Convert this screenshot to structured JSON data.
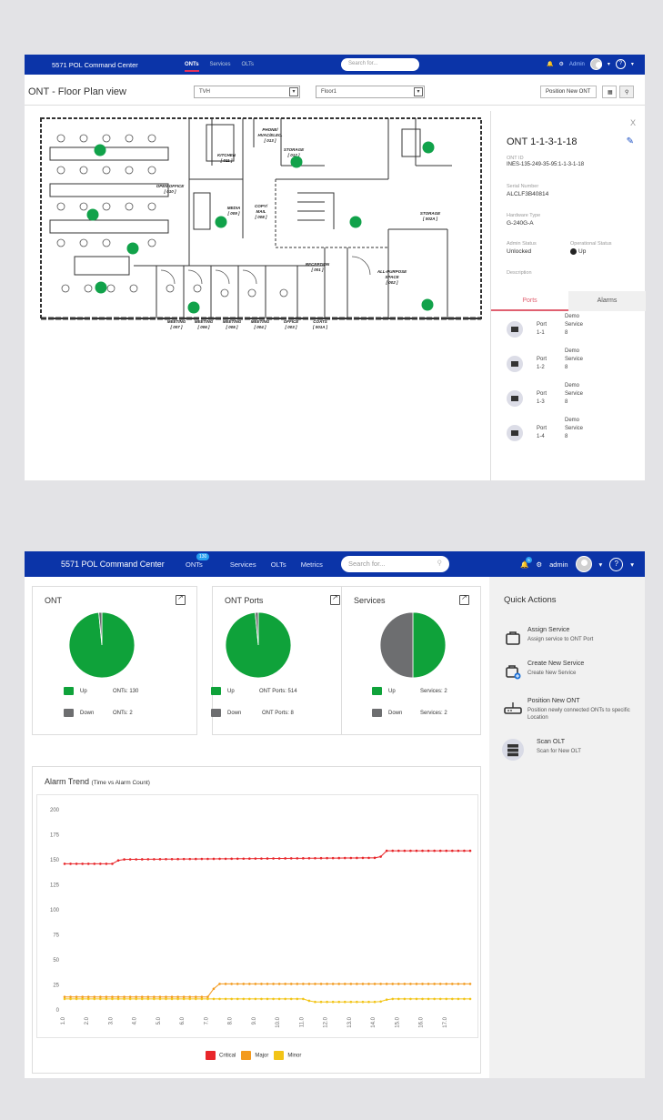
{
  "floor_plan_view": {
    "app_title": "5571 POL Command Center",
    "nav": [
      "ONTs",
      "Services",
      "OLTs"
    ],
    "search_placeholder": "Search for...",
    "user": "Admin",
    "page_title": "ONT - Floor Plan view",
    "building_select": "TVH",
    "floor_select": "Floor1",
    "position_button": "Position New ONT",
    "rooms": [
      "OPEN OFFICE",
      "[ 010 ]",
      "KITCHEN",
      "[ 011 ]",
      "PHONE/",
      "HVAC/ELEC.",
      "[ 013 ]",
      "STORAGE",
      "[ 012 ]",
      "MEDIA",
      "[ 009 ]",
      "COPY/",
      "MAIL",
      "[ 008 ]",
      "STORAGE",
      "[ 002A ]",
      "RECEPTION",
      "[ 001 ]",
      "ALL-PURPOSE",
      "SPACE",
      "[ 002 ]",
      "MEETING",
      "[ 007 ]",
      "MEETING",
      "[ 006 ]",
      "MEETING",
      "[ 005 ]",
      "MEETING",
      "[ 004 ]",
      "OFFICE",
      "[ 003 ]",
      "COATS",
      "[ 001A ]"
    ],
    "ont_detail": {
      "close": "X",
      "name": "ONT 1-1-3-1-18",
      "ont_id_label": "ONT ID",
      "ont_id": "INES-135-249-35-95:1-1-3-1-18",
      "serial_label": "Serial Number",
      "serial": "ALCLF3B40814",
      "hw_label": "Hardware Type",
      "hw": "G-240G-A",
      "admin_label": "Admin Status",
      "admin": "Unlocked",
      "oper_label": "Operational Status",
      "oper": "Up",
      "desc_label": "Description",
      "tabs": [
        "Ports",
        "Alarms"
      ],
      "ports": [
        {
          "port": [
            "Port",
            "1-1"
          ],
          "service": [
            "Demo",
            "Service",
            "8"
          ]
        },
        {
          "port": [
            "Port",
            "1-2"
          ],
          "service": [
            "Demo",
            "Service",
            "8"
          ]
        },
        {
          "port": [
            "Port",
            "1-3"
          ],
          "service": [
            "Demo",
            "Service",
            "8"
          ]
        },
        {
          "port": [
            "Port",
            "1-4"
          ],
          "service": [
            "Demo",
            "Service",
            "8"
          ]
        }
      ]
    }
  },
  "dashboard": {
    "app_title": "5571 POL Command Center",
    "nav": [
      "ONTs",
      "Services",
      "OLTs",
      "Metrics"
    ],
    "onts_badge": "130",
    "search_placeholder": "Search for...",
    "bell_badge": "5",
    "user": "admin",
    "cards": [
      {
        "title": "ONT",
        "up_label": "Up",
        "up_text": "ONTs: 130",
        "down_label": "Down",
        "down_text": "ONTs: 2"
      },
      {
        "title": "ONT Ports",
        "up_label": "Up",
        "up_text": "ONT Ports: 514",
        "down_label": "Down",
        "down_text": "ONT Ports: 8"
      },
      {
        "title": "Services",
        "up_label": "Up",
        "up_text": "Services: 2",
        "down_label": "Down",
        "down_text": "Services: 2"
      }
    ],
    "quick_actions": {
      "title": "Quick Actions",
      "items": [
        {
          "name": "Assign Service",
          "desc": "Assign service to ONT Port"
        },
        {
          "name": "Create New Service",
          "desc": "Create New Service"
        },
        {
          "name": "Position New ONT",
          "desc": "Position newly connected ONTs to specific Location"
        },
        {
          "name": "Scan OLT",
          "desc": "Scan for New OLT"
        }
      ]
    },
    "trend_title": "Alarm Trend",
    "trend_subtitle": "(Time vs Alarm Count)"
  },
  "colors": {
    "up": "#0fa23a",
    "down": "#6d6e70",
    "critical": "#e8262a",
    "major": "#f39a1e",
    "minor": "#f2c417",
    "nav_bg": "#0b34a8"
  },
  "chart_data": [
    {
      "type": "pie",
      "title": "ONT",
      "categories": [
        "Up",
        "Down"
      ],
      "values": [
        130,
        2
      ]
    },
    {
      "type": "pie",
      "title": "ONT Ports",
      "categories": [
        "Up",
        "Down"
      ],
      "values": [
        514,
        8
      ]
    },
    {
      "type": "pie",
      "title": "Services",
      "categories": [
        "Up",
        "Down"
      ],
      "values": [
        2,
        2
      ]
    },
    {
      "type": "line",
      "title": "Alarm Trend",
      "subtitle": "(Time vs Alarm Count)",
      "y_ticks": [
        0,
        25,
        50,
        75,
        100,
        125,
        150,
        175,
        200
      ],
      "ylim": [
        0,
        200
      ],
      "x_ticks": [
        "1.0",
        "2.0",
        "3.0",
        "4.0",
        "5.0",
        "6.0",
        "7.0",
        "8.0",
        "9.0",
        "10.0",
        "11.0",
        "12.0",
        "13.0",
        "14.0",
        "15.0",
        "16.0",
        "17.0"
      ],
      "x_range": [
        1,
        18
      ],
      "grid": false,
      "legend": "bottom",
      "series": [
        {
          "name": "Critical",
          "x": [
            1,
            2,
            3,
            3.3,
            18
          ],
          "y": [
            146,
            146,
            146,
            150,
            150
          ],
          "x2": [
            1,
            14.2,
            14.5,
            18
          ],
          "y2": [
            150,
            152,
            159,
            159
          ]
        },
        {
          "name": "Major",
          "x": [
            1,
            7,
            7.4,
            18
          ],
          "y": [
            13,
            13,
            26,
            26
          ]
        },
        {
          "name": "Minor",
          "x": [
            1,
            11,
            11.4,
            14.2,
            14.6,
            18
          ],
          "y": [
            11,
            11,
            8,
            8,
            11,
            11
          ]
        }
      ]
    }
  ]
}
